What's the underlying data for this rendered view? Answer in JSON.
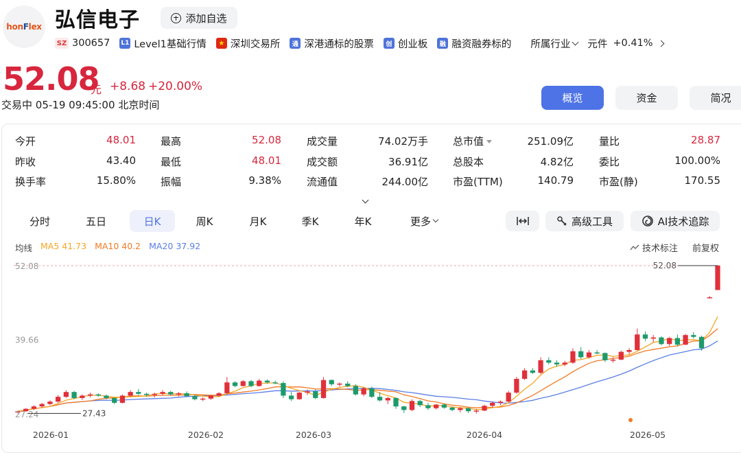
{
  "header": {
    "logo_text_a": "hon",
    "logo_text_b": "F",
    "logo_text_c": "lex",
    "name": "弘信电子",
    "add_watch_label": "添加自选",
    "tags": {
      "market_code": "SZ",
      "code": "300657",
      "level_icon": "L1",
      "level": "Level1基础行情",
      "exchange": "深圳交易所",
      "hk_icon": "通",
      "hk_connect": "深港通标的股票",
      "board_icon": "创",
      "board": "创业板",
      "margin_icon": "融",
      "margin": "融资融券标的",
      "industry_label": "所属行业",
      "industry_name": "元件",
      "industry_change": "+0.41%"
    }
  },
  "quote": {
    "price": "52.08",
    "unit": "元",
    "change": "+8.68",
    "change_pct": "+20.00%",
    "status": "交易中",
    "datetime": "05-19 09:45:00",
    "timezone": "北京时间"
  },
  "nav": {
    "overview": "概览",
    "funds": "资金",
    "brief": "简况"
  },
  "stats": {
    "open_label": "今开",
    "open": "48.01",
    "prev_close_label": "昨收",
    "prev_close": "43.40",
    "turnover_label": "换手率",
    "turnover": "15.80%",
    "high_label": "最高",
    "high": "52.08",
    "low_label": "最低",
    "low": "48.01",
    "amplitude_label": "振幅",
    "amplitude": "9.38%",
    "volume_label": "成交量",
    "volume": "74.02万手",
    "amount_label": "成交额",
    "amount": "36.91亿",
    "float_cap_label": "流通值",
    "float_cap": "244.00亿",
    "mkt_cap_label": "总市值",
    "mkt_cap": "251.09亿",
    "shares_label": "总股本",
    "shares": "4.82亿",
    "pe_ttm_label": "市盈(TTM)",
    "pe_ttm": "140.79",
    "vol_ratio_label": "量比",
    "vol_ratio": "28.87",
    "bid_ratio_label": "委比",
    "bid_ratio": "100.00%",
    "pe_static_label": "市盈(静)",
    "pe_static": "170.55"
  },
  "periods": [
    "分时",
    "五日",
    "日K",
    "周K",
    "月K",
    "季K",
    "年K",
    "更多"
  ],
  "tools": {
    "advanced": "高级工具",
    "ai": "AI技术追踪"
  },
  "legend": {
    "title": "均线",
    "ma5": "MA5 41.73",
    "ma10": "MA10 40.2",
    "ma20": "MA20 37.92",
    "tech_mark": "技术标注",
    "adjust": "前复权"
  },
  "colors": {
    "up": "#e0303a",
    "down": "#1d9a6c",
    "ma5": "#f5a623",
    "ma10": "#f07a24",
    "ma20": "#5b7ee5",
    "accent": "#4e73e6"
  },
  "chart_data": {
    "type": "candlestick",
    "y_labels": [
      "52.08",
      "39.66",
      "27.24"
    ],
    "max_marker": "52.08",
    "min_marker": "27.43",
    "x_labels": [
      "2026-01",
      "2026-02",
      "2026-03",
      "2026-04",
      "2026-05"
    ],
    "ylim": [
      27.24,
      52.08
    ],
    "candles": [
      [
        27.6,
        27.9,
        27.4,
        27.8
      ],
      [
        27.8,
        28.3,
        27.7,
        28.2
      ],
      [
        28.2,
        28.8,
        28.0,
        28.6
      ],
      [
        28.6,
        29.2,
        28.4,
        29.0
      ],
      [
        29.0,
        29.6,
        28.8,
        29.4
      ],
      [
        29.4,
        30.5,
        29.2,
        30.2
      ],
      [
        30.2,
        31.3,
        30.0,
        31.0
      ],
      [
        31.0,
        31.2,
        29.8,
        30.0
      ],
      [
        30.0,
        30.6,
        29.7,
        30.4
      ],
      [
        30.4,
        30.9,
        30.1,
        30.6
      ],
      [
        30.6,
        30.8,
        30.2,
        30.4
      ],
      [
        30.4,
        30.6,
        29.8,
        30.0
      ],
      [
        30.0,
        30.1,
        29.0,
        29.2
      ],
      [
        29.2,
        30.6,
        29.1,
        30.4
      ],
      [
        30.4,
        31.3,
        30.2,
        31.0
      ],
      [
        31.0,
        31.5,
        30.5,
        30.7
      ],
      [
        30.7,
        30.9,
        30.2,
        30.5
      ],
      [
        30.5,
        30.9,
        30.1,
        30.7
      ],
      [
        30.7,
        31.3,
        30.5,
        31.0
      ],
      [
        31.0,
        31.2,
        30.4,
        30.6
      ],
      [
        30.6,
        31.0,
        30.3,
        30.8
      ],
      [
        30.8,
        31.1,
        30.2,
        30.3
      ],
      [
        30.3,
        30.5,
        29.6,
        29.8
      ],
      [
        29.8,
        30.1,
        29.5,
        29.9
      ],
      [
        29.9,
        30.5,
        29.7,
        30.4
      ],
      [
        30.4,
        31.0,
        30.2,
        30.8
      ],
      [
        30.8,
        33.5,
        30.6,
        32.6
      ],
      [
        32.6,
        32.8,
        31.8,
        32.0
      ],
      [
        32.0,
        33.0,
        31.9,
        32.8
      ],
      [
        32.8,
        33.0,
        31.8,
        32.0
      ],
      [
        32.0,
        33.2,
        31.9,
        32.9
      ],
      [
        32.9,
        33.1,
        32.4,
        32.6
      ],
      [
        32.6,
        32.9,
        32.3,
        32.5
      ],
      [
        32.5,
        32.8,
        30.0,
        30.4
      ],
      [
        30.4,
        31.0,
        29.5,
        29.8
      ],
      [
        29.8,
        31.0,
        29.7,
        30.9
      ],
      [
        30.9,
        31.4,
        30.5,
        31.1
      ],
      [
        31.1,
        31.4,
        29.8,
        30.0
      ],
      [
        30.0,
        33.5,
        29.9,
        33.0
      ],
      [
        33.0,
        33.1,
        32.0,
        32.3
      ],
      [
        32.3,
        32.6,
        31.9,
        32.4
      ],
      [
        32.4,
        32.8,
        31.8,
        32.0
      ],
      [
        32.0,
        32.3,
        30.4,
        30.6
      ],
      [
        30.6,
        31.8,
        30.3,
        31.6
      ],
      [
        31.6,
        31.9,
        30.0,
        30.2
      ],
      [
        30.2,
        31.0,
        29.4,
        29.6
      ],
      [
        29.6,
        30.2,
        29.0,
        30.0
      ],
      [
        30.0,
        30.1,
        28.2,
        28.6
      ],
      [
        28.6,
        28.7,
        27.5,
        28.0
      ],
      [
        28.0,
        29.8,
        27.8,
        29.5
      ],
      [
        29.5,
        29.7,
        28.5,
        28.8
      ],
      [
        28.8,
        29.2,
        28.0,
        28.3
      ],
      [
        28.3,
        29.0,
        28.1,
        28.9
      ],
      [
        28.9,
        29.1,
        28.2,
        28.4
      ],
      [
        28.4,
        28.6,
        27.8,
        28.0
      ],
      [
        28.0,
        28.5,
        27.6,
        28.3
      ],
      [
        28.3,
        28.4,
        27.5,
        27.8
      ],
      [
        27.8,
        28.2,
        27.4,
        27.9
      ],
      [
        27.9,
        28.9,
        27.8,
        28.7
      ],
      [
        28.7,
        29.4,
        28.4,
        29.2
      ],
      [
        29.2,
        29.6,
        28.8,
        29.4
      ],
      [
        29.4,
        31.2,
        29.3,
        30.9
      ],
      [
        30.9,
        33.5,
        30.7,
        33.2
      ],
      [
        33.2,
        35.0,
        33.0,
        34.6
      ],
      [
        34.6,
        35.0,
        34.0,
        34.2
      ],
      [
        34.2,
        36.8,
        34.0,
        36.3
      ],
      [
        36.3,
        36.8,
        35.6,
        35.9
      ],
      [
        35.9,
        36.3,
        35.2,
        35.6
      ],
      [
        35.6,
        36.2,
        35.3,
        35.9
      ],
      [
        35.9,
        38.3,
        35.7,
        37.8
      ],
      [
        37.8,
        38.5,
        36.5,
        36.8
      ],
      [
        36.8,
        38.0,
        36.6,
        37.6
      ],
      [
        37.6,
        38.0,
        37.3,
        37.5
      ],
      [
        37.5,
        37.6,
        36.0,
        36.3
      ],
      [
        36.3,
        36.8,
        35.9,
        36.4
      ],
      [
        36.4,
        37.9,
        36.3,
        37.7
      ],
      [
        37.7,
        38.3,
        37.3,
        38.0
      ],
      [
        38.0,
        41.6,
        37.9,
        40.6
      ],
      [
        40.6,
        41.1,
        39.5,
        39.9
      ],
      [
        39.9,
        40.5,
        39.3,
        40.1
      ],
      [
        40.1,
        40.3,
        38.8,
        39.0
      ],
      [
        39.0,
        40.2,
        38.7,
        40.0
      ],
      [
        40.0,
        40.6,
        38.6,
        38.9
      ],
      [
        38.9,
        40.7,
        38.8,
        40.5
      ],
      [
        40.5,
        41.0,
        39.9,
        40.2
      ],
      [
        40.2,
        40.4,
        37.9,
        38.3
      ],
      [
        46.8,
        47.0,
        46.6,
        46.8
      ],
      [
        48.01,
        52.08,
        48.01,
        52.08
      ]
    ]
  }
}
